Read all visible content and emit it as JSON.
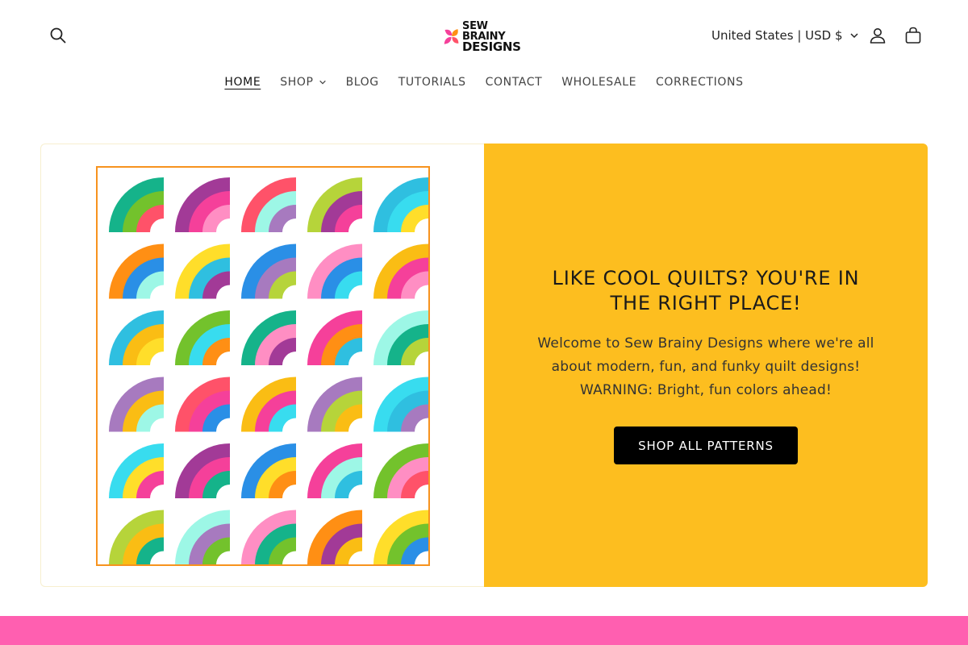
{
  "header": {
    "logo_text_line1": "SEW BRAINY",
    "logo_text_line2": "DESIGNS",
    "region_label": "United States | USD $",
    "icons": {
      "search": "search-icon",
      "account": "user-icon",
      "cart": "cart-icon",
      "region_chevron": "chevron-down-icon"
    }
  },
  "nav": {
    "items": [
      {
        "label": "HOME",
        "active": true
      },
      {
        "label": "SHOP",
        "has_dropdown": true
      },
      {
        "label": "BLOG"
      },
      {
        "label": "TUTORIALS"
      },
      {
        "label": "CONTACT"
      },
      {
        "label": "WHOLESALE"
      },
      {
        "label": "CORRECTIONS"
      }
    ]
  },
  "hero": {
    "title": "LIKE COOL QUILTS? YOU'RE IN THE RIGHT PLACE!",
    "body_line1": "Welcome to Sew Brainy Designs where we're all",
    "body_line2": "about modern, fun, and funky quilt designs!",
    "body_line3": "WARNING: Bright, fun colors ahead!",
    "button_label": "SHOP ALL PATTERNS",
    "panel_color": "#fdbe1f",
    "quilt_border_color": "#f7931e"
  },
  "colors": {
    "accent_pink": "#ff5fb0",
    "button_bg": "#000000",
    "quilt_palette": [
      "#15b38a",
      "#ff5269",
      "#a23a97",
      "#ff8ec3",
      "#b6d43a",
      "#38dcef",
      "#ffde2a",
      "#ff8f14",
      "#2a8fe6",
      "#a77abf",
      "#73c22c",
      "#f5409a",
      "#9df7e6",
      "#fabd14",
      "#f55a6e",
      "#ffb01f"
    ]
  },
  "quilt": {
    "rows": [
      [
        [
          "#15b38a",
          "#73c22c",
          "#ff5269"
        ],
        [
          "#a23a97",
          "#f5409a",
          "#ff8ec3"
        ],
        [
          "#ff5269",
          "#9df7e6",
          "#a77abf"
        ],
        [
          "#b6d43a",
          "#a23a97",
          "#f5409a"
        ],
        [
          "#2fbfe0",
          "#38dcef",
          "#ffde2a"
        ]
      ],
      [
        [
          "#ff8f14",
          "#2a8fe6",
          "#9df7e6"
        ],
        [
          "#ffde2a",
          "#2fbfe0",
          "#a23a97"
        ],
        [
          "#2a8fe6",
          "#a77abf",
          "#b6d43a"
        ],
        [
          "#ff8ec3",
          "#2a8fe6",
          "#38dcef"
        ],
        [
          "#fabd14",
          "#f5409a",
          "#ff8ec3"
        ]
      ],
      [
        [
          "#2fbfe0",
          "#fabd14",
          "#ffde2a"
        ],
        [
          "#73c22c",
          "#38dcef",
          "#ff8f14"
        ],
        [
          "#15b38a",
          "#ff8ec3",
          "#a23a97"
        ],
        [
          "#f5409a",
          "#ff8f14",
          "#2fbfe0"
        ],
        [
          "#9df7e6",
          "#15b38a",
          "#b6d43a"
        ]
      ],
      [
        [
          "#a77abf",
          "#fabd14",
          "#9df7e6"
        ],
        [
          "#ff5269",
          "#f5409a",
          "#2a8fe6"
        ],
        [
          "#fabd14",
          "#f5409a",
          "#38dcef"
        ],
        [
          "#a77abf",
          "#b6d43a",
          "#fabd14"
        ],
        [
          "#38dcef",
          "#2fbfe0",
          "#a77abf"
        ]
      ],
      [
        [
          "#38dcef",
          "#ffde2a",
          "#f5409a"
        ],
        [
          "#a23a97",
          "#f5409a",
          "#15b38a"
        ],
        [
          "#2a8fe6",
          "#ffde2a",
          "#ff8f14"
        ],
        [
          "#f5409a",
          "#9df7e6",
          "#2fbfe0"
        ],
        [
          "#73c22c",
          "#ff8ec3",
          "#ff5269"
        ]
      ],
      [
        [
          "#b6d43a",
          "#fabd14",
          "#15b38a"
        ],
        [
          "#9df7e6",
          "#a77abf",
          "#73c22c"
        ],
        [
          "#ff8ec3",
          "#15b38a",
          "#73c22c"
        ],
        [
          "#ff8f14",
          "#a23a97",
          "#fabd14"
        ],
        [
          "#ffde2a",
          "#73c22c",
          "#2a8fe6"
        ]
      ]
    ]
  }
}
